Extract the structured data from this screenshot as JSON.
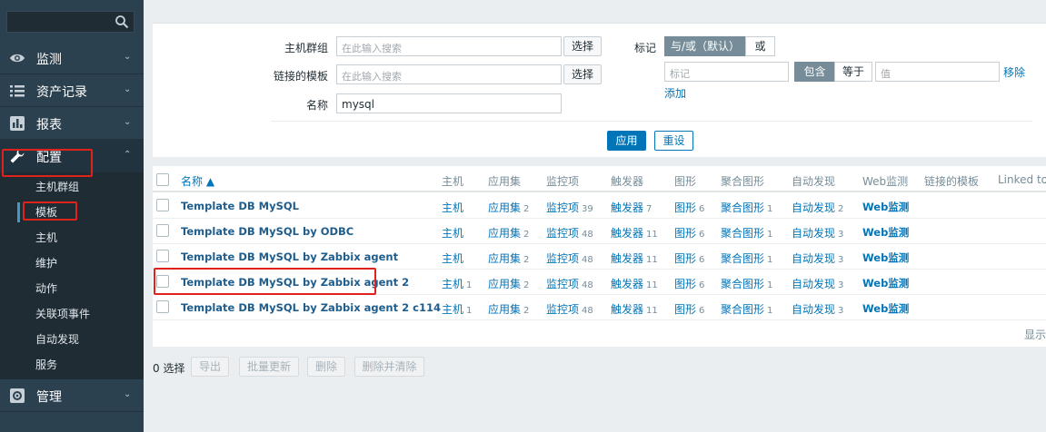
{
  "sidebar": {
    "search": {
      "value": ""
    },
    "menu": [
      {
        "label": "监测",
        "icon": "eye-icon"
      },
      {
        "label": "资产记录",
        "icon": "list-icon"
      },
      {
        "label": "报表",
        "icon": "bar-chart-icon"
      },
      {
        "label": "配置",
        "icon": "wrench-icon"
      },
      {
        "label": "管理",
        "icon": "gear-icon"
      }
    ],
    "config_submenu": [
      "主机群组",
      "模板",
      "主机",
      "维护",
      "动作",
      "关联项事件",
      "自动发现",
      "服务"
    ]
  },
  "filter": {
    "host_group_label": "主机群组",
    "host_group_placeholder": "在此输入搜索",
    "linked_template_label": "链接的模板",
    "linked_template_placeholder": "在此输入搜索",
    "name_label": "名称",
    "name_value": "mysql",
    "select_label": "选择",
    "tags_label": "标记",
    "tag_mode_and": "与/或（默认）",
    "tag_mode_or": "或",
    "tag_placeholder": "标记",
    "op_contains": "包含",
    "op_equals": "等于",
    "value_placeholder": "值",
    "remove_label": "移除",
    "add_label": "添加",
    "apply_label": "应用",
    "reset_label": "重设"
  },
  "table": {
    "headers": [
      "名称 ▲",
      "主机",
      "应用集",
      "监控项",
      "触发器",
      "图形",
      "聚合图形",
      "自动发现",
      "Web监测",
      "链接的模板",
      "Linked to te"
    ],
    "rows": [
      {
        "name": "Template DB MySQL",
        "hosts": "主机",
        "hosts_count": "",
        "apps": "应用集",
        "apps_count": "2",
        "items": "监控项",
        "items_count": "39",
        "triggers": "触发器",
        "triggers_count": "7",
        "graphs": "图形",
        "graphs_count": "6",
        "screens": "聚合图形",
        "screens_count": "1",
        "discovery": "自动发现",
        "discovery_count": "2",
        "web": "Web监测"
      },
      {
        "name": "Template DB MySQL by ODBC",
        "hosts": "主机",
        "hosts_count": "",
        "apps": "应用集",
        "apps_count": "2",
        "items": "监控项",
        "items_count": "48",
        "triggers": "触发器",
        "triggers_count": "11",
        "graphs": "图形",
        "graphs_count": "6",
        "screens": "聚合图形",
        "screens_count": "1",
        "discovery": "自动发现",
        "discovery_count": "3",
        "web": "Web监测"
      },
      {
        "name": "Template DB MySQL by Zabbix agent",
        "hosts": "主机",
        "hosts_count": "",
        "apps": "应用集",
        "apps_count": "2",
        "items": "监控项",
        "items_count": "48",
        "triggers": "触发器",
        "triggers_count": "11",
        "graphs": "图形",
        "graphs_count": "6",
        "screens": "聚合图形",
        "screens_count": "1",
        "discovery": "自动发现",
        "discovery_count": "3",
        "web": "Web监测"
      },
      {
        "name": "Template DB MySQL by Zabbix agent 2",
        "hosts": "主机",
        "hosts_count": "1",
        "apps": "应用集",
        "apps_count": "2",
        "items": "监控项",
        "items_count": "48",
        "triggers": "触发器",
        "triggers_count": "11",
        "graphs": "图形",
        "graphs_count": "6",
        "screens": "聚合图形",
        "screens_count": "1",
        "discovery": "自动发现",
        "discovery_count": "3",
        "web": "Web监测"
      },
      {
        "name": "Template DB MySQL by Zabbix agent 2 c114",
        "hosts": "主机",
        "hosts_count": "1",
        "apps": "应用集",
        "apps_count": "2",
        "items": "监控项",
        "items_count": "48",
        "triggers": "触发器",
        "triggers_count": "11",
        "graphs": "图形",
        "graphs_count": "6",
        "screens": "聚合图形",
        "screens_count": "1",
        "discovery": "自动发现",
        "discovery_count": "3",
        "web": "Web监测"
      }
    ],
    "footer": "显示"
  },
  "actions": {
    "selected": "0 选择",
    "export": "导出",
    "mass_update": "批量更新",
    "delete": "删除",
    "delete_clear": "删除并清除"
  },
  "colors": {
    "sidebar": "#2b4150",
    "link": "#0275b8",
    "highlight": "#e0221d"
  }
}
